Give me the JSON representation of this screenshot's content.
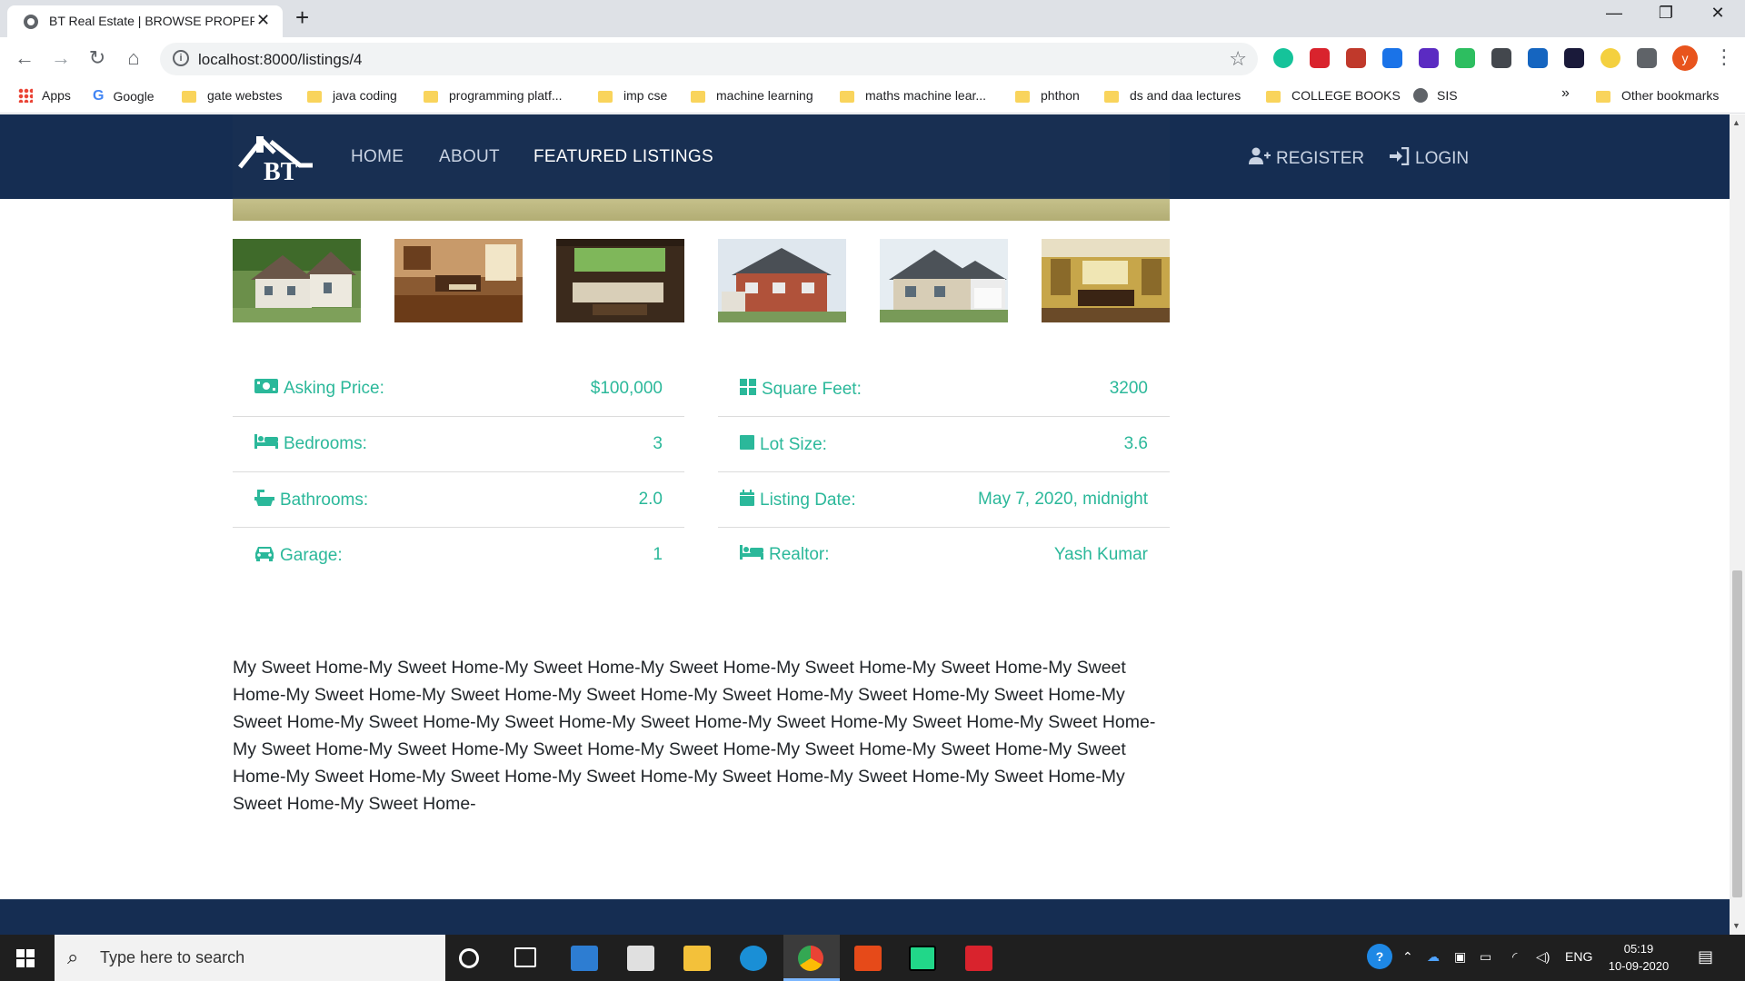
{
  "browser": {
    "tab_title": "BT Real Estate | BROWSE PROPERTIES",
    "tab_close": "✕",
    "new_tab": "+",
    "url": "localhost:8000/listings/4",
    "window_controls": {
      "minimize": "—",
      "restore": "❐",
      "close": "✕"
    },
    "profile_initial": "y",
    "extensions": [
      {
        "name": "grammarly-icon",
        "color": "#15c39a"
      },
      {
        "name": "mendeley-icon",
        "color": "#d9232d"
      },
      {
        "name": "megaphone-icon",
        "color": "#c0392b"
      },
      {
        "name": "puzzle-blue-icon",
        "color": "#1a73e8"
      },
      {
        "name": "graduation-cap-icon",
        "color": "#5b2bc2"
      },
      {
        "name": "evernote-icon",
        "color": "#2dbe60"
      },
      {
        "name": "selenium-icon",
        "color": "#43474d"
      },
      {
        "name": "speed-icon",
        "color": "#1565c0"
      },
      {
        "name": "dark-ext-icon",
        "color": "#1a1a3a"
      },
      {
        "name": "arrow-circle-icon",
        "color": "#f4d03f"
      },
      {
        "name": "extensions-puzzle-icon",
        "color": "#5f6368"
      }
    ]
  },
  "bookmarks": {
    "items": [
      {
        "label": "Apps",
        "type": "apps"
      },
      {
        "label": "Google",
        "type": "google"
      },
      {
        "label": "gate webstes",
        "type": "folder"
      },
      {
        "label": "java coding",
        "type": "folder"
      },
      {
        "label": "programming platf...",
        "type": "folder"
      },
      {
        "label": "imp cse",
        "type": "folder"
      },
      {
        "label": "machine learning",
        "type": "folder"
      },
      {
        "label": "maths machine lear...",
        "type": "folder"
      },
      {
        "label": "phthon",
        "type": "folder"
      },
      {
        "label": "ds and daa lectures",
        "type": "folder"
      },
      {
        "label": "COLLEGE BOOKS",
        "type": "folder"
      },
      {
        "label": "SIS",
        "type": "globe"
      }
    ],
    "overflow": "»",
    "other": "Other bookmarks"
  },
  "navbar": {
    "logo_text": "BT",
    "links": [
      "HOME",
      "ABOUT",
      "FEATURED LISTINGS"
    ],
    "active_link": "FEATURED LISTINGS",
    "register": "REGISTER",
    "login": "LOGIN"
  },
  "listing": {
    "details_left": [
      {
        "label": "Asking Price:",
        "value": "$100,000",
        "icon": "money-icon"
      },
      {
        "label": "Bedrooms:",
        "value": "3",
        "icon": "bed-icon"
      },
      {
        "label": "Bathrooms:",
        "value": "2.0",
        "icon": "bath-icon"
      },
      {
        "label": "Garage:",
        "value": "1",
        "icon": "car-icon"
      }
    ],
    "details_right": [
      {
        "label": "Square Feet:",
        "value": "3200",
        "icon": "grid-icon"
      },
      {
        "label": "Lot Size:",
        "value": "3.6",
        "icon": "square-icon"
      },
      {
        "label": "Listing Date:",
        "value": "May 7, 2020, midnight",
        "icon": "calendar-icon"
      },
      {
        "label": "Realtor:",
        "value": "Yash Kumar",
        "icon": "bed-icon"
      }
    ],
    "description": "My Sweet Home-My Sweet Home-My Sweet Home-My Sweet Home-My Sweet Home-My Sweet Home-My Sweet Home-My Sweet Home-My Sweet Home-My Sweet Home-My Sweet Home-My Sweet Home-My Sweet Home-My Sweet Home-My Sweet Home-My Sweet Home-My Sweet Home-My Sweet Home-My Sweet Home-My Sweet Home-My Sweet Home-My Sweet Home-My Sweet Home-My Sweet Home-My Sweet Home-My Sweet Home-My Sweet Home-My Sweet Home-My Sweet Home-My Sweet Home-My Sweet Home-My Sweet Home-My Sweet Home-My Sweet Home-My Sweet Home-",
    "accent_color": "#2bb89a"
  },
  "taskbar": {
    "search_placeholder": "Type here to search",
    "language": "ENG",
    "time": "05:19",
    "date": "10-09-2020"
  }
}
